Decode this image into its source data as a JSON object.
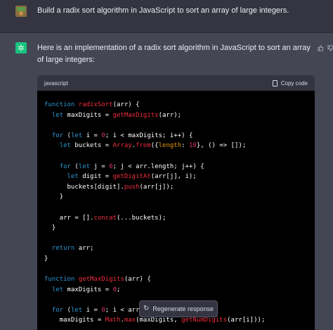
{
  "user_message": {
    "text": "Build a radix sort algorithm in JavaScript to sort an array of large integers."
  },
  "assistant_message": {
    "text": "Here is an implementation of a radix sort algorithm in JavaScript to sort an array of large integers:"
  },
  "code_block": {
    "language": "javascript",
    "copy_label": "Copy code",
    "lines": [
      [
        {
          "t": "function ",
          "c": "kw"
        },
        {
          "t": "radixSort",
          "c": "fn"
        },
        {
          "t": "(arr) {",
          "c": "pl"
        }
      ],
      [
        {
          "t": "  ",
          "c": "pl"
        },
        {
          "t": "let ",
          "c": "kw"
        },
        {
          "t": "maxDigits = ",
          "c": "pl"
        },
        {
          "t": "getMaxDigits",
          "c": "fn"
        },
        {
          "t": "(arr);",
          "c": "pl"
        }
      ],
      [],
      [
        {
          "t": "  ",
          "c": "pl"
        },
        {
          "t": "for ",
          "c": "kw"
        },
        {
          "t": "(",
          "c": "pl"
        },
        {
          "t": "let ",
          "c": "kw"
        },
        {
          "t": "i = ",
          "c": "pl"
        },
        {
          "t": "0",
          "c": "num"
        },
        {
          "t": "; i < maxDigits; i++) {",
          "c": "pl"
        }
      ],
      [
        {
          "t": "    ",
          "c": "pl"
        },
        {
          "t": "let ",
          "c": "kw"
        },
        {
          "t": "buckets = ",
          "c": "pl"
        },
        {
          "t": "Array",
          "c": "fn"
        },
        {
          "t": ".",
          "c": "pl"
        },
        {
          "t": "from",
          "c": "fn"
        },
        {
          "t": "({",
          "c": "pl"
        },
        {
          "t": "length",
          "c": "attr"
        },
        {
          "t": ": ",
          "c": "pl"
        },
        {
          "t": "10",
          "c": "num"
        },
        {
          "t": "}, () => []);",
          "c": "pl"
        }
      ],
      [],
      [
        {
          "t": "    ",
          "c": "pl"
        },
        {
          "t": "for ",
          "c": "kw"
        },
        {
          "t": "(",
          "c": "pl"
        },
        {
          "t": "let ",
          "c": "kw"
        },
        {
          "t": "j = ",
          "c": "pl"
        },
        {
          "t": "0",
          "c": "num"
        },
        {
          "t": "; j < arr.length; j++) {",
          "c": "pl"
        }
      ],
      [
        {
          "t": "      ",
          "c": "pl"
        },
        {
          "t": "let ",
          "c": "kw"
        },
        {
          "t": "digit = ",
          "c": "pl"
        },
        {
          "t": "getDigitAt",
          "c": "fn"
        },
        {
          "t": "(arr[j], i);",
          "c": "pl"
        }
      ],
      [
        {
          "t": "      buckets[digit].",
          "c": "pl"
        },
        {
          "t": "push",
          "c": "fn"
        },
        {
          "t": "(arr[j]);",
          "c": "pl"
        }
      ],
      [
        {
          "t": "    }",
          "c": "pl"
        }
      ],
      [],
      [
        {
          "t": "    arr = [].",
          "c": "pl"
        },
        {
          "t": "concat",
          "c": "fn"
        },
        {
          "t": "(...buckets);",
          "c": "pl"
        }
      ],
      [
        {
          "t": "  }",
          "c": "pl"
        }
      ],
      [],
      [
        {
          "t": "  ",
          "c": "pl"
        },
        {
          "t": "return ",
          "c": "kw"
        },
        {
          "t": "arr;",
          "c": "pl"
        }
      ],
      [
        {
          "t": "}",
          "c": "pl"
        }
      ],
      [],
      [
        {
          "t": "function ",
          "c": "kw"
        },
        {
          "t": "getMaxDigits",
          "c": "fn"
        },
        {
          "t": "(arr) {",
          "c": "pl"
        }
      ],
      [
        {
          "t": "  ",
          "c": "pl"
        },
        {
          "t": "let ",
          "c": "kw"
        },
        {
          "t": "maxDigits = ",
          "c": "pl"
        },
        {
          "t": "0",
          "c": "num"
        },
        {
          "t": ";",
          "c": "pl"
        }
      ],
      [],
      [
        {
          "t": "  ",
          "c": "pl"
        },
        {
          "t": "for ",
          "c": "kw"
        },
        {
          "t": "(",
          "c": "pl"
        },
        {
          "t": "let ",
          "c": "kw"
        },
        {
          "t": "i = ",
          "c": "pl"
        },
        {
          "t": "0",
          "c": "num"
        },
        {
          "t": "; i < arr.length; i++) {",
          "c": "pl"
        }
      ],
      [
        {
          "t": "    maxDigits = ",
          "c": "pl"
        },
        {
          "t": "Math",
          "c": "fn"
        },
        {
          "t": ".",
          "c": "pl"
        },
        {
          "t": "max",
          "c": "fn"
        },
        {
          "t": "(maxDigits, ",
          "c": "pl"
        },
        {
          "t": "getNumDigits",
          "c": "fn"
        },
        {
          "t": "(arr[i]));",
          "c": "pl"
        }
      ]
    ]
  },
  "regenerate_label": "Regenerate response",
  "icons": {
    "copy": "clipboard-icon",
    "regenerate": "refresh-icon",
    "thumbs_up": "thumbs-up-icon",
    "thumbs_down": "thumbs-down-icon",
    "assistant_avatar": "openai-logo-icon",
    "user_avatar": "user-avatar"
  },
  "colors": {
    "keyword": "#2e95d3",
    "function": "#f22c3d",
    "number": "#df3079",
    "attribute": "#e9950c",
    "plain": "#ffffff",
    "page_bg": "#343541",
    "assistant_bg": "#444654",
    "code_bg": "#000000",
    "avatar_green": "#19c37d"
  }
}
